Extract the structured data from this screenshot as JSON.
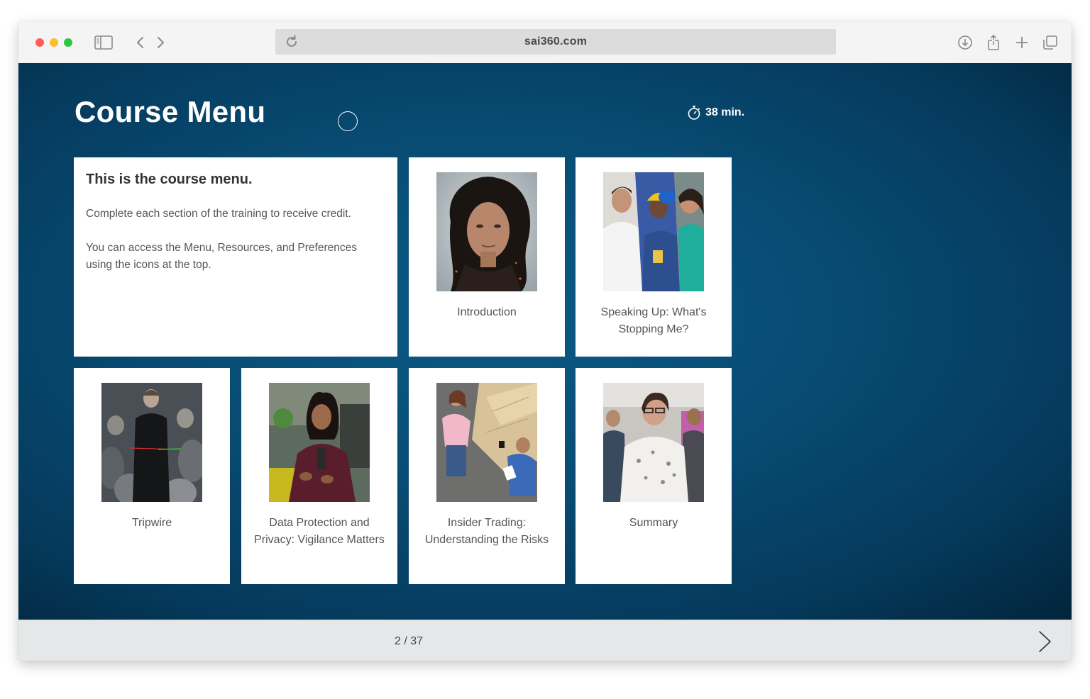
{
  "browser": {
    "url": "sai360.com"
  },
  "course": {
    "title": "Course Menu",
    "duration": "38 min."
  },
  "intro": {
    "heading": "This is the course menu.",
    "paragraph1": "Complete each section of the training to receive credit.",
    "paragraph2": "You can access the Menu, Resources, and Preferences using the icons at the top."
  },
  "modules": [
    {
      "label": "Introduction"
    },
    {
      "label": "Speaking Up: What's Stopping Me?"
    },
    {
      "label": "Tripwire"
    },
    {
      "label": "Data Protection and Privacy: Vigilance Matters"
    },
    {
      "label": "Insider Trading: Understanding the Risks"
    },
    {
      "label": "Summary"
    }
  ],
  "footer": {
    "page_counter": "2 / 37"
  },
  "colors": {
    "stage_background": "#084c74",
    "card_background": "#ffffff",
    "footer_background": "#e6e7e8"
  }
}
